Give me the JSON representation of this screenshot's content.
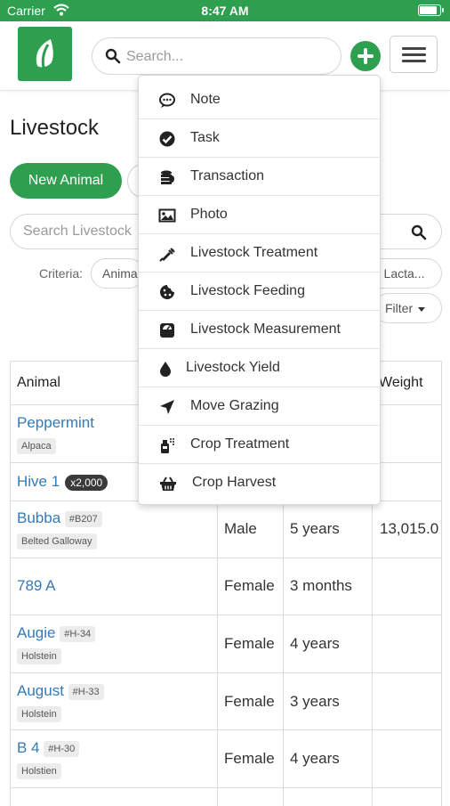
{
  "status_bar": {
    "carrier": "Carrier",
    "time": "8:47 AM",
    "battery_level": 0.9
  },
  "header": {
    "search_placeholder": "Search...",
    "logo_icon": "leaf-logo-icon"
  },
  "page": {
    "title": "Livestock",
    "new_animal_label": "New Animal",
    "search_placeholder": "Search Livestock",
    "criteria_label": "Criteria:",
    "criteria_chips": [
      "Anima",
      "r Lacta..."
    ],
    "filter_label": "Filter"
  },
  "table": {
    "headers": {
      "animal": "Animal",
      "weight": "Weight"
    },
    "rows": [
      {
        "name": "Peppermint",
        "tag_id": "",
        "breed": "Alpaca",
        "count": "",
        "sex": "",
        "age": "",
        "weight": ""
      },
      {
        "name": "Hive 1",
        "tag_id": "",
        "breed": "",
        "count": "x2,000",
        "sex": "",
        "age": "",
        "weight": ""
      },
      {
        "name": "Bubba",
        "tag_id": "#B207",
        "breed": "Belted Galloway",
        "count": "",
        "sex": "Male",
        "age": "5 years",
        "weight": "13,015.0"
      },
      {
        "name": "789 A",
        "tag_id": "",
        "breed": "",
        "count": "",
        "sex": "Female",
        "age": "3 months",
        "weight": ""
      },
      {
        "name": "Augie",
        "tag_id": "#H-34",
        "breed": "Holstein",
        "count": "",
        "sex": "Female",
        "age": "4 years",
        "weight": ""
      },
      {
        "name": "August",
        "tag_id": "#H-33",
        "breed": "Holstein",
        "count": "",
        "sex": "Female",
        "age": "3 years",
        "weight": ""
      },
      {
        "name": "B 4",
        "tag_id": "#H-30",
        "breed": "Holstien",
        "count": "",
        "sex": "Female",
        "age": "4 years",
        "weight": ""
      }
    ]
  },
  "add_menu": {
    "items": [
      {
        "label": "Note",
        "icon": "comment-icon"
      },
      {
        "label": "Task",
        "icon": "check-circle-icon"
      },
      {
        "label": "Transaction",
        "icon": "coins-icon"
      },
      {
        "label": "Photo",
        "icon": "image-icon"
      },
      {
        "label": "Livestock Treatment",
        "icon": "syringe-icon"
      },
      {
        "label": "Livestock Feeding",
        "icon": "cookie-icon"
      },
      {
        "label": "Livestock Measurement",
        "icon": "scale-icon"
      },
      {
        "label": "Livestock Yield",
        "icon": "drop-icon"
      },
      {
        "label": "Move Grazing",
        "icon": "location-arrow-icon"
      },
      {
        "label": "Crop Treatment",
        "icon": "spray-bottle-icon"
      },
      {
        "label": "Crop Harvest",
        "icon": "basket-icon"
      }
    ]
  },
  "colors": {
    "brand_green": "#2e9e4f",
    "link_blue": "#3579b8"
  }
}
